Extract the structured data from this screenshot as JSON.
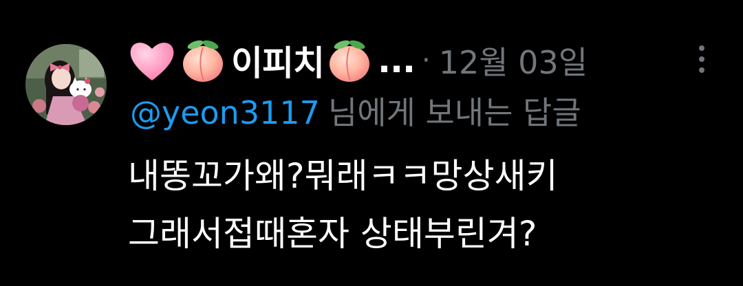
{
  "tweet": {
    "author": {
      "display_name": "이피치",
      "name_emojis": [
        "pink-heart-emoji",
        "peach-emoji",
        "peach-emoji"
      ],
      "truncation": "...",
      "avatar": "avatar"
    },
    "separator": "·",
    "date": "12월 03일",
    "more_icon": "more-vertical-icon",
    "reply_to": {
      "handle": "@yeon3117",
      "suffix": "님에게 보내는 답글"
    },
    "body": "내똥꼬가왜?뭐래ㅋㅋ망상새키\n그래서접때혼자 상태부린겨?"
  },
  "colors": {
    "background": "#000000",
    "text": "#ffffff",
    "muted": "#71767b",
    "link": "#1d9bf0"
  }
}
